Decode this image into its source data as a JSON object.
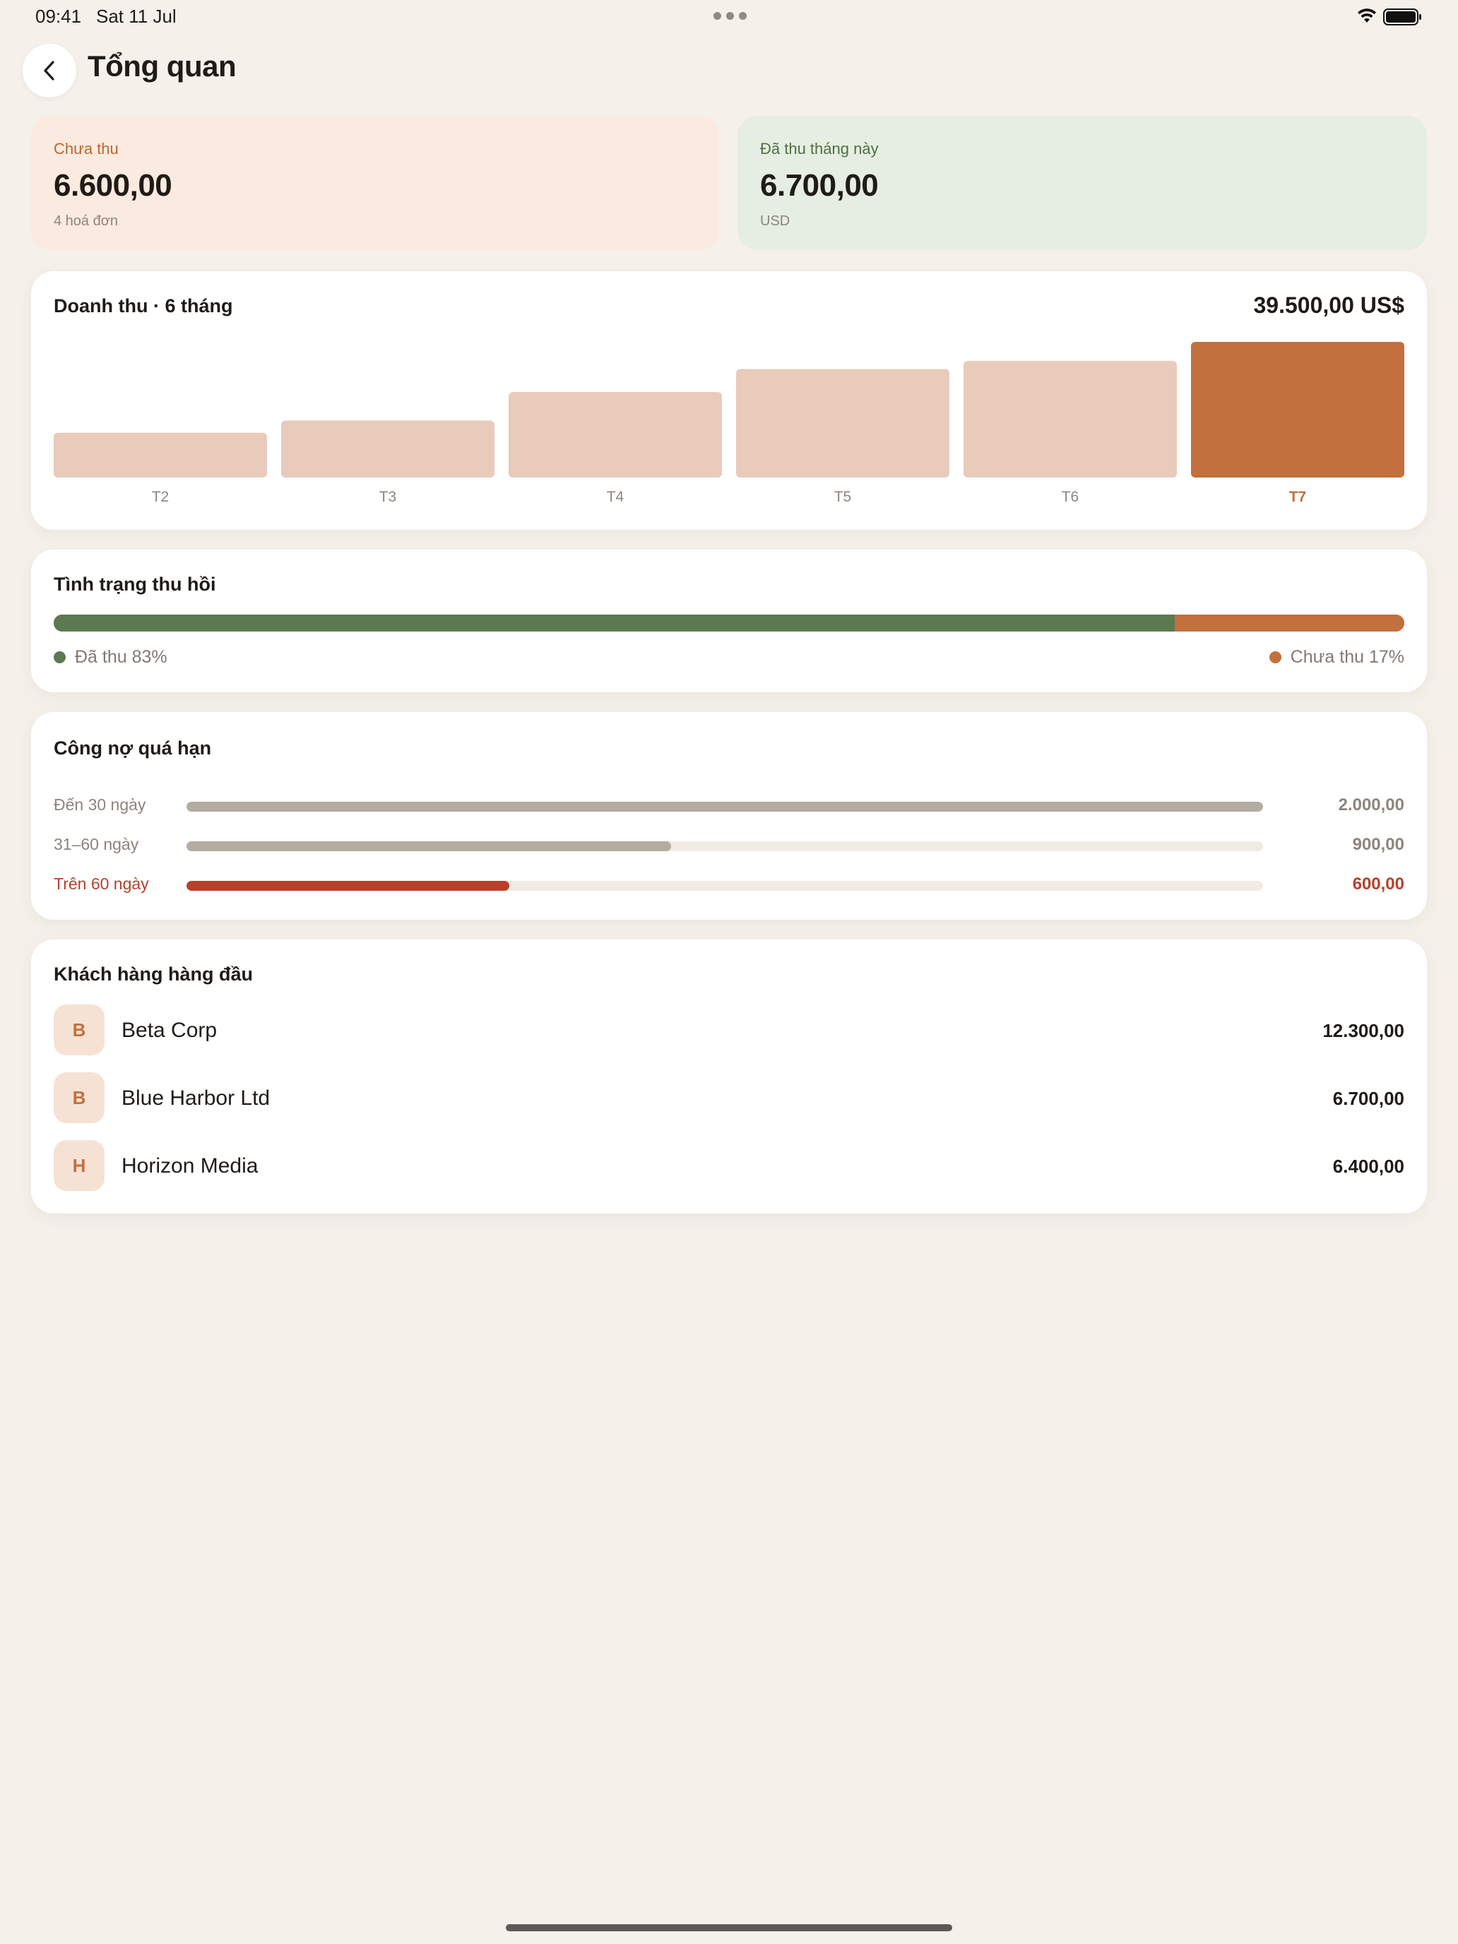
{
  "status_bar": {
    "time": "09:41",
    "date": "Sat 11 Jul"
  },
  "header": {
    "title": "Tổng quan"
  },
  "summary": {
    "unpaid": {
      "label": "Chưa thu",
      "value": "6.600,00",
      "sub": "4 hoá đơn"
    },
    "paid": {
      "label": "Đã thu tháng này",
      "value": "6.700,00",
      "sub": "USD"
    }
  },
  "revenue": {
    "title": "Doanh thu · 6 tháng",
    "total": "39.500,00 US$"
  },
  "chart_data": {
    "type": "bar",
    "title": "Doanh thu · 6 tháng",
    "categories": [
      "T2",
      "T3",
      "T4",
      "T5",
      "T6",
      "T7"
    ],
    "values": [
      3.3,
      4.2,
      6.3,
      8.0,
      8.6,
      10.0
    ],
    "highlight_index": 5,
    "ylim": [
      0,
      10
    ],
    "grid": false,
    "colors": {
      "bar": "#e8cbbb",
      "highlight": "#c2703d",
      "label": "#8c857d"
    }
  },
  "collection": {
    "title": "Tình trạng thu hồi",
    "paid_percent": 83,
    "paid_label": "Đã thu 83%",
    "unpaid_label": "Chưa thu 17%",
    "colors": {
      "paid": "#5b7a50",
      "unpaid": "#c2703d"
    }
  },
  "overdue": {
    "title": "Công nợ quá hạn",
    "rows": [
      {
        "label": "Đến 30 ngày",
        "value": "2.000,00",
        "fraction": 1.0
      },
      {
        "label": "31–60 ngày",
        "value": "900,00",
        "fraction": 0.45
      },
      {
        "label": "Trên 60 ngày",
        "value": "600,00",
        "fraction": 0.3
      }
    ]
  },
  "customers": {
    "title": "Khách hàng hàng đầu",
    "items": [
      {
        "initial": "B",
        "name": "Beta Corp",
        "amount": "12.300,00"
      },
      {
        "initial": "B",
        "name": "Blue Harbor Ltd",
        "amount": "6.700,00"
      },
      {
        "initial": "H",
        "name": "Horizon Media",
        "amount": "6.400,00"
      }
    ]
  }
}
